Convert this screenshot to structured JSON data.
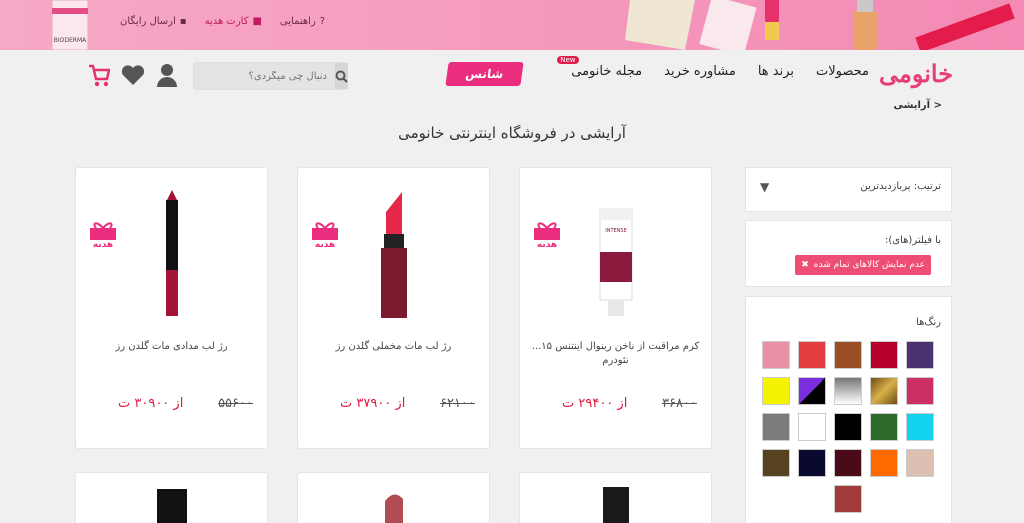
{
  "topbar": {
    "links": [
      {
        "label": "راهنمایی",
        "icon": "question-circle-icon"
      },
      {
        "label": "کارت هدیه",
        "icon": "gift-icon"
      },
      {
        "label": "ارسال رایگان",
        "icon": "truck-icon"
      }
    ],
    "deco_brand": "BIODERMA"
  },
  "nav": {
    "logo": "خانومی",
    "menu": [
      "محصولات",
      "برند ها",
      "مشاوره خرید",
      "مجله خانومی"
    ],
    "new_badge": "New",
    "chance": "شانس",
    "search_placeholder": "دنبال چی میگردی؟"
  },
  "breadcrumb": "آرایشی >",
  "page_title": "آرایشی در فروشگاه اینترنتی خانومی",
  "sort": {
    "label": "ترتیب: پربازدیدترین"
  },
  "filters": {
    "title": "با فیلتر(های):",
    "tag": "عدم نمایش کالاهای تمام شده"
  },
  "colors": {
    "title": "رنگ‌ها",
    "swatches": [
      "#4b3270",
      "#b5002b",
      "#9a5024",
      "#e53e42",
      "#e891a6",
      "#cc3064",
      "#a37a28",
      "#bdbdbd",
      "#7b2ee0",
      "#f4f400",
      "#12d2f0",
      "#2e6a2a",
      "#000000",
      "#ffffff",
      "#7b7b7b",
      "#dcc1b2",
      "#ff6a00",
      "#4a0a18",
      "#0a0a30",
      "#564221",
      "#a33b3b"
    ]
  },
  "products": [
    {
      "name": "کرم مراقبت از ناخن رینوال اینتنس ۱۵... نئودرم",
      "old": "۳۶۸۰۰",
      "new": "از ۲۹۴۰۰ ت",
      "gift": "هدیه",
      "type": "cream",
      "mini": "INTENSE"
    },
    {
      "name": "رژ لب مات مخملی گلدن رز",
      "old": "۶۲۱۰۰",
      "new": "از ۳۷۹۰۰ ت",
      "gift": "هدیه",
      "type": "lipstick"
    },
    {
      "name": "رژ لب مدادی مات گلدن رز",
      "old": "۵۵۶۰۰",
      "new": "از ۳۰۹۰۰ ت",
      "gift": "هدیه",
      "type": "pencil"
    }
  ]
}
